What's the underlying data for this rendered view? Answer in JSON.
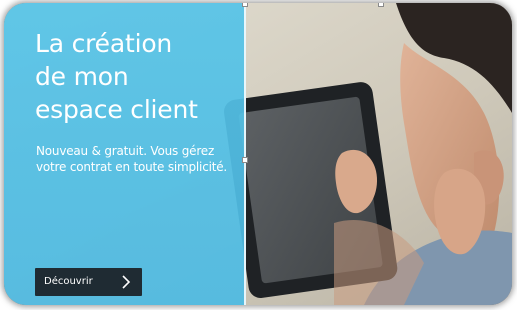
{
  "banner": {
    "title_lines": [
      "La création",
      "de mon",
      "espace client"
    ],
    "description": "Nouveau & gratuit. Vous gérez votre contrat en toute simplicité.",
    "cta_label": "Découvrir",
    "cta_icon": "chevron-right-icon",
    "photo": "man-using-tablet"
  },
  "colors": {
    "panel": "#56c4e8",
    "button": "#1f2b33",
    "text": "#ffffff"
  }
}
